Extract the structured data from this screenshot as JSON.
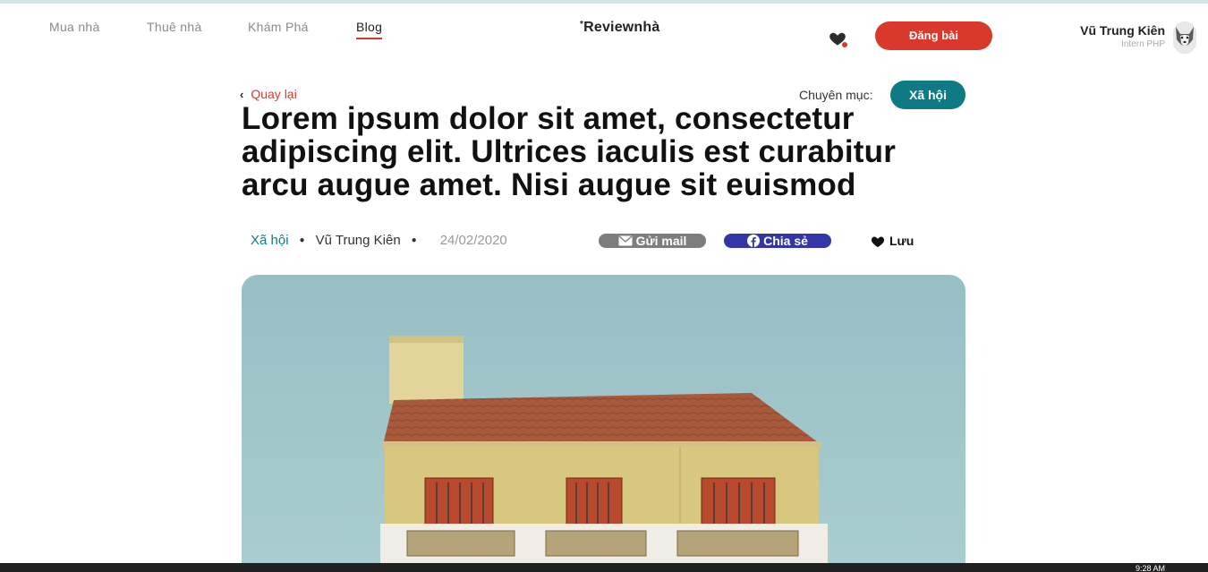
{
  "nav": {
    "items": [
      {
        "label": "Mua nhà"
      },
      {
        "label": "Thuê nhà"
      },
      {
        "label": "Khám Phá"
      },
      {
        "label": "Blog"
      }
    ],
    "logo": "Reviewnhà",
    "post_button": "Đăng bài",
    "user_name": "Vũ Trung Kiên",
    "user_role": "Intern PHP"
  },
  "article": {
    "back_label": "Quay lại",
    "category_label": "Chuyên mục:",
    "category_pill": "Xã hội",
    "title": "Lorem ipsum dolor sit amet, consectetur adipiscing elit. Ultrices iaculis est curabitur arcu augue amet. Nisi augue sit euismod",
    "meta": {
      "category": "Xã hội",
      "author": "Vũ Trung Kiên",
      "date": "24/02/2020"
    },
    "actions": {
      "mail": "Gửi mail",
      "share": "Chia sẻ",
      "save": "Lưu"
    }
  },
  "taskbar": {
    "clock": "9:28 AM"
  },
  "colors": {
    "accent": "#d9392b",
    "teal": "#0e7b84",
    "share_blue": "#3436a8",
    "mail_gray": "#7d7d7d",
    "sky": "#97bfc4"
  },
  "icons": [
    "heart-notification-icon",
    "chevron-left-icon",
    "mail-icon",
    "facebook-icon",
    "heart-icon"
  ]
}
